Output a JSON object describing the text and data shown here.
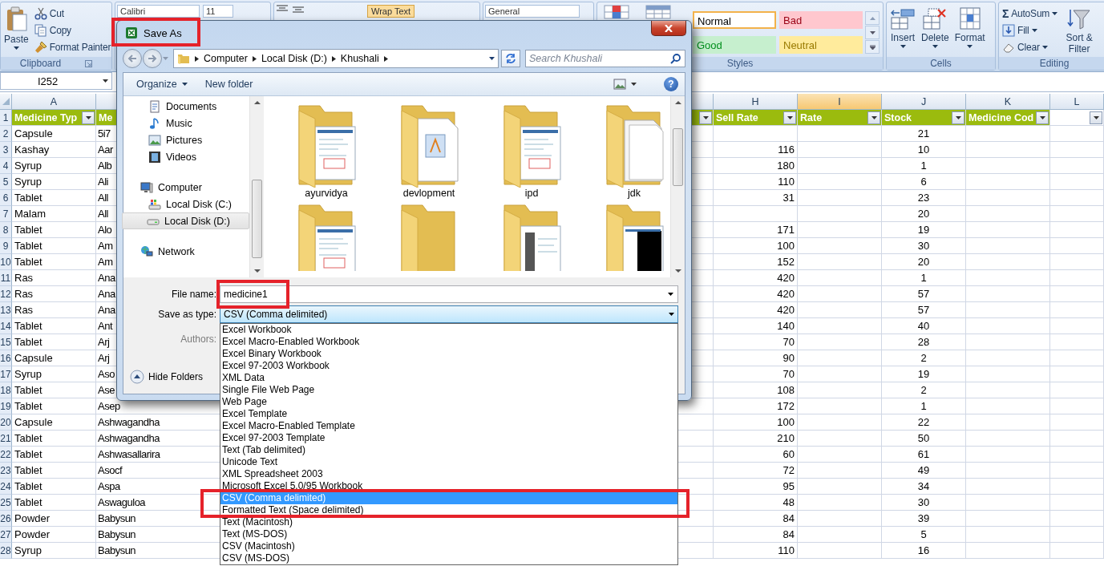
{
  "ribbon": {
    "groups": [
      {
        "kind": "clipboard",
        "label": "Clipboard",
        "paste": "Paste",
        "commands": [
          {
            "label": "Cut",
            "kind": "cut"
          },
          {
            "label": "Copy",
            "kind": "copy"
          },
          {
            "label": "Format Painter",
            "kind": "painter"
          }
        ]
      },
      {
        "kind": "font",
        "font": "Calibri",
        "size": "11"
      },
      {
        "kind": "alignment",
        "wrap": "Wrap Text"
      },
      {
        "kind": "number",
        "format": "General"
      },
      {
        "kind": "styles",
        "label": "Styles",
        "swatches": [
          {
            "label": "Normal",
            "color": "#ffffff",
            "selected": true
          },
          {
            "label": "Bad",
            "color": "#ffc7ce",
            "selected": false
          },
          {
            "label": "Good",
            "color": "#c6efce",
            "selected": false
          },
          {
            "label": "Neutral",
            "color": "#ffeb9c",
            "selected": false
          }
        ]
      },
      {
        "kind": "cells",
        "label": "Cells",
        "commands": [
          {
            "label": "Insert",
            "kind": "insert"
          },
          {
            "label": "Delete",
            "kind": "delete"
          },
          {
            "label": "Format",
            "kind": "format"
          }
        ]
      },
      {
        "kind": "editing",
        "label": "Editing",
        "commands": [
          {
            "label": "AutoSum",
            "kind": "autosum",
            "symbol": "Σ"
          },
          {
            "label": "Fill",
            "kind": "fill"
          },
          {
            "label": "Clear",
            "kind": "clear"
          }
        ],
        "sort": "Sort & Filter"
      }
    ]
  },
  "name_box": "I252",
  "sheet": {
    "header_row": "1",
    "columns": [
      {
        "letter": "A",
        "header": "Medicine Typ",
        "in_table": true,
        "filter": true,
        "selected": false
      },
      {
        "header": "Me",
        "in_table": true,
        "filter": false
      },
      {
        "in_table": true,
        "filter": true
      },
      {
        "letter": "H",
        "header": "Sell Rate",
        "in_table": true,
        "filter": true,
        "selected": false
      },
      {
        "letter": "I",
        "header": "Rate",
        "in_table": true,
        "filter": true,
        "selected": true
      },
      {
        "letter": "J",
        "header": "Stock",
        "in_table": true,
        "filter": true,
        "selected": false
      },
      {
        "letter": "K",
        "header": "Medicine Cod",
        "in_table": true,
        "filter": true,
        "selected": false
      },
      {
        "letter": "L",
        "in_table": false,
        "filter": true,
        "selected": false
      }
    ],
    "rows": [
      {
        "number": "2",
        "type": "Capsule",
        "name": "5i7",
        "stock": "21"
      },
      {
        "number": "3",
        "type": "Kashay",
        "name": "Aar",
        "sell_rate": "116",
        "stock": "10"
      },
      {
        "number": "4",
        "type": "Syrup",
        "name": "Alb",
        "sell_rate": "180",
        "stock": "1"
      },
      {
        "number": "5",
        "type": "Syrup",
        "name": "Ali",
        "sell_rate": "110",
        "stock": "6"
      },
      {
        "number": "6",
        "type": "Tablet",
        "name": "All",
        "sell_rate": "31",
        "stock": "23"
      },
      {
        "number": "7",
        "type": "Malam",
        "name": "All",
        "stock": "20"
      },
      {
        "number": "8",
        "type": "Tablet",
        "name": "Alo",
        "sell_rate": "171",
        "stock": "19"
      },
      {
        "number": "9",
        "type": "Tablet",
        "name": "Am",
        "sell_rate": "100",
        "stock": "30"
      },
      {
        "number": "10",
        "type": "Tablet",
        "name": "Am",
        "sell_rate": "152",
        "stock": "20"
      },
      {
        "number": "11",
        "type": "Ras",
        "name": "Ana",
        "sell_rate": "420",
        "stock": "1"
      },
      {
        "number": "12",
        "type": "Ras",
        "name": "Ana",
        "sell_rate": "420",
        "stock": "57"
      },
      {
        "number": "13",
        "type": "Ras",
        "name": "Ana",
        "sell_rate": "420",
        "stock": "57"
      },
      {
        "number": "14",
        "type": "Tablet",
        "name": "Ant",
        "sell_rate": "140",
        "stock": "40"
      },
      {
        "number": "15",
        "type": "Tablet",
        "name": "Arj",
        "sell_rate": "70",
        "stock": "28"
      },
      {
        "number": "16",
        "type": "Capsule",
        "name": "Arj",
        "sell_rate": "90",
        "stock": "2"
      },
      {
        "number": "17",
        "type": "Syrup",
        "name": "Aso",
        "sell_rate": "70",
        "stock": "19"
      },
      {
        "number": "18",
        "type": "Tablet",
        "name": "Ase",
        "sell_rate": "108",
        "stock": "2"
      },
      {
        "number": "19",
        "type": "Tablet",
        "name": "Asep",
        "sell_rate": "172",
        "stock": "1"
      },
      {
        "number": "20",
        "type": "Capsule",
        "name": "Ashwagandha",
        "sell_rate": "100",
        "stock": "22"
      },
      {
        "number": "21",
        "type": "Tablet",
        "name": "Ashwagandha",
        "sell_rate": "210",
        "stock": "50"
      },
      {
        "number": "22",
        "type": "Tablet",
        "name": "Ashwasallarira",
        "sell_rate": "60",
        "stock": "61"
      },
      {
        "number": "23",
        "type": "Tablet",
        "name": "Asocf",
        "sell_rate": "72",
        "stock": "49"
      },
      {
        "number": "24",
        "type": "Tablet",
        "name": "Aspa",
        "sell_rate": "95",
        "stock": "34"
      },
      {
        "number": "25",
        "type": "Tablet",
        "name": "Aswaguloa",
        "sell_rate": "48",
        "stock": "30"
      },
      {
        "number": "26",
        "type": "Powder",
        "name": "Babysun",
        "sell_rate": "84",
        "stock": "39"
      },
      {
        "number": "27",
        "type": "Powder",
        "name": "Babysun",
        "sell_rate": "84",
        "stock": "5"
      },
      {
        "number": "28",
        "type": "Syrup",
        "name": "Babysun",
        "sell_rate": "110",
        "stock": "16"
      }
    ]
  },
  "dialog": {
    "title": "Save As",
    "title_highlighted": true,
    "path": [
      "Computer",
      "Local Disk (D:)",
      "Khushali"
    ],
    "search": {
      "placeholder": "Search Khushali"
    },
    "toolbar": {
      "organize": "Organize",
      "new_folder": "New folder",
      "help": "?"
    },
    "nav": [
      {
        "children": [
          {
            "label": "Documents",
            "kind": "documents",
            "selected": false
          },
          {
            "label": "Music",
            "kind": "music",
            "selected": false
          },
          {
            "label": "Pictures",
            "kind": "pictures",
            "selected": false
          },
          {
            "label": "Videos",
            "kind": "videos",
            "selected": false
          }
        ]
      },
      {
        "label": "Computer",
        "kind": "computer",
        "selected": false,
        "children": [
          {
            "label": "Local Disk (C:)",
            "kind": "system_drive",
            "selected": false
          },
          {
            "label": "Local Disk (D:)",
            "kind": "drive",
            "selected": true
          }
        ]
      },
      {
        "label": "Network",
        "kind": "network",
        "selected": false
      }
    ],
    "folders": [
      {
        "name": "ayurvidya",
        "kind": "screens"
      },
      {
        "name": "devlopment",
        "kind": "document"
      },
      {
        "name": "ipd",
        "kind": "screens"
      },
      {
        "name": "jdk",
        "kind": "pages"
      },
      {
        "kind": "screens"
      },
      {
        "kind": "empty"
      },
      {
        "kind": "dark"
      },
      {
        "kind": "black"
      }
    ],
    "file_name": {
      "label": "File name:",
      "value": "medicine1",
      "highlighted": true
    },
    "save_type": {
      "label": "Save as type:",
      "value": "CSV (Comma delimited)",
      "expanded": true,
      "options": [
        {
          "label": "Excel Workbook",
          "selected": false,
          "highlighted": false
        },
        {
          "label": "Excel Macro-Enabled Workbook",
          "selected": false,
          "highlighted": false
        },
        {
          "label": "Excel Binary Workbook",
          "selected": false,
          "highlighted": false
        },
        {
          "label": "Excel 97-2003 Workbook",
          "selected": false,
          "highlighted": false
        },
        {
          "label": "XML Data",
          "selected": false,
          "highlighted": false
        },
        {
          "label": "Single File Web Page",
          "selected": false,
          "highlighted": false
        },
        {
          "label": "Web Page",
          "selected": false,
          "highlighted": false
        },
        {
          "label": "Excel Template",
          "selected": false,
          "highlighted": false
        },
        {
          "label": "Excel Macro-Enabled Template",
          "selected": false,
          "highlighted": false
        },
        {
          "label": "Excel 97-2003 Template",
          "selected": false,
          "highlighted": false
        },
        {
          "label": "Text (Tab delimited)",
          "selected": false,
          "highlighted": false
        },
        {
          "label": "Unicode Text",
          "selected": false,
          "highlighted": false
        },
        {
          "label": "XML Spreadsheet 2003",
          "selected": false,
          "highlighted": false
        },
        {
          "label": "Microsoft Excel 5.0/95 Workbook",
          "selected": false,
          "highlighted": false
        },
        {
          "label": "CSV (Comma delimited)",
          "selected": true,
          "highlighted": true
        },
        {
          "label": "Formatted Text (Space delimited)",
          "selected": false,
          "highlighted": true
        },
        {
          "label": "Text (Macintosh)",
          "selected": false,
          "highlighted": false
        },
        {
          "label": "Text (MS-DOS)",
          "selected": false,
          "highlighted": false
        },
        {
          "label": "CSV (Macintosh)",
          "selected": false,
          "highlighted": false
        },
        {
          "label": "CSV (MS-DOS)",
          "selected": false,
          "highlighted": false
        }
      ]
    },
    "authors": {
      "label": "Authors:"
    },
    "hide_folders": "Hide Folders"
  }
}
